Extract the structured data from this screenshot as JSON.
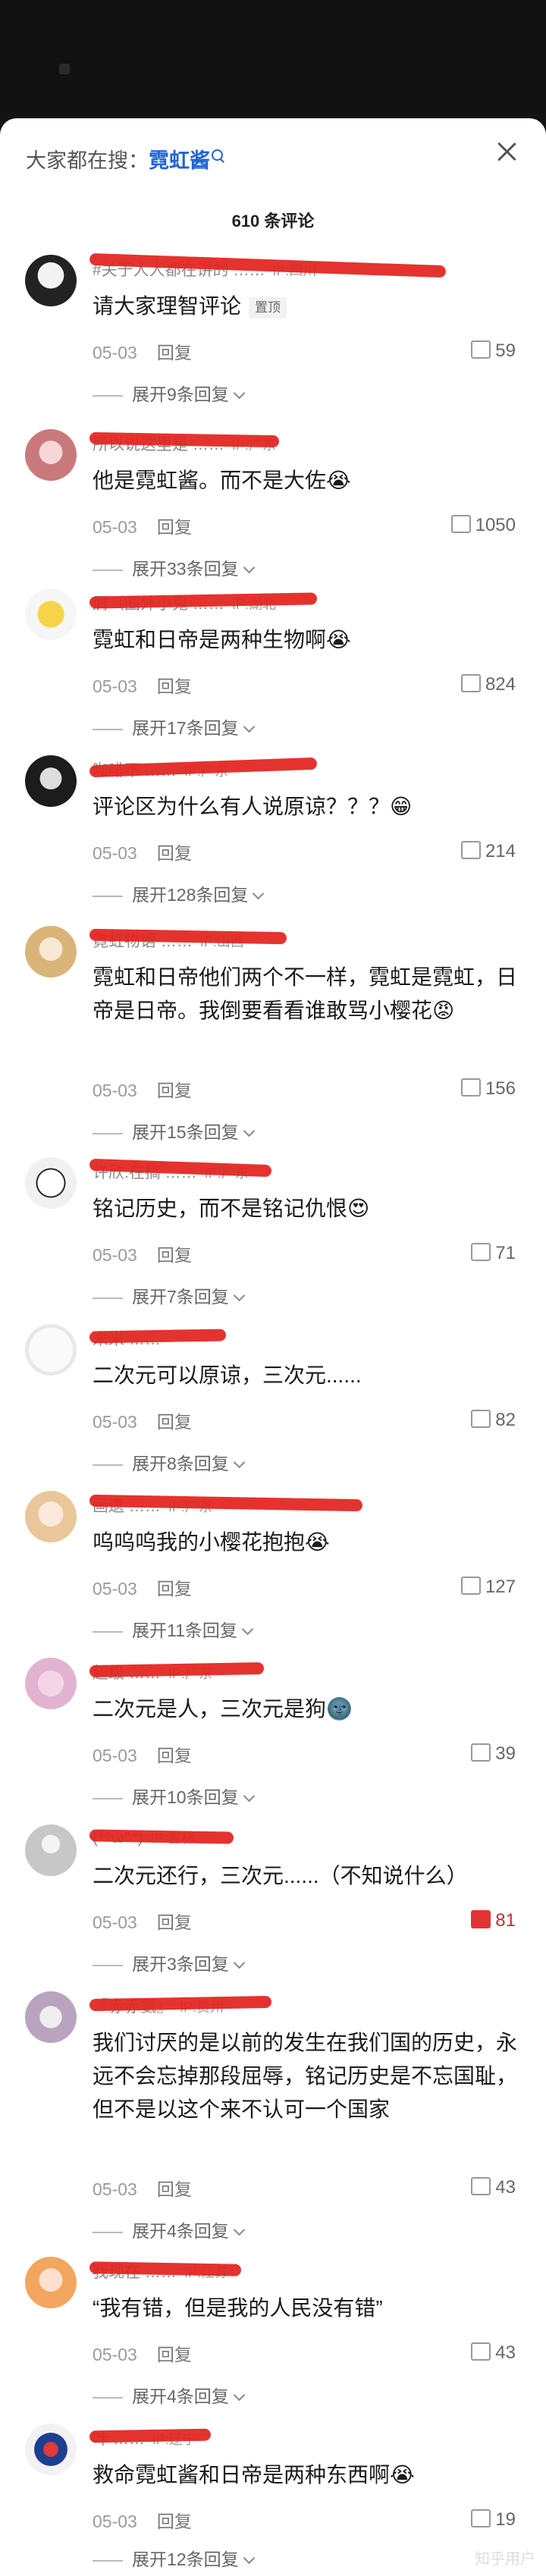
{
  "search": {
    "prefix": "大家都在搜：",
    "keyword": "霓虹酱"
  },
  "comment_count": "610 条评论",
  "actions": {
    "reply": "回复"
  },
  "watermark": "知乎用户",
  "colors": {
    "accent": "#1f64d8",
    "redact": "#e2231f",
    "liked": "#e23333"
  },
  "comments": [
    {
      "user": "#关于人人都在讲的 ……",
      "ip": "IP:四川",
      "text": "请大家理智评论",
      "tag": "置顶",
      "date": "05-03",
      "likes": "59",
      "expand": "展开9条回复"
    },
    {
      "user": "所以说这里是 ……",
      "ip": "IP:广东",
      "text": "他是霓虹酱。而不是大佐😭",
      "date": "05-03",
      "likes": "1050",
      "expand": "展开33条回复"
    },
    {
      "user": "屑（圈外小鬼 ……",
      "ip": "IP:湖北",
      "text": "霓虹和日帝是两种生物啊😭",
      "date": "05-03",
      "likes": "824",
      "expand": "展开17条回复"
    },
    {
      "user": "咖啡不 ……",
      "ip": "IP:广东",
      "text": "评论区为什么有人说原谅？？？😁",
      "date": "05-03",
      "likes": "214",
      "expand": "展开128条回复"
    },
    {
      "user": "霓虹物语 ……",
      "ip": "IP:山西",
      "text": "霓虹和日帝他们两个不一样，霓虹是霓虹，日帝是日帝。我倒要看看谁敢骂小樱花😡",
      "date": "05-03",
      "likes": "156",
      "expand": "展开15条回复"
    },
    {
      "user": "许欣.在搞 ……",
      "ip": "IP:广东",
      "text": "铭记历史，而不是铭记仇恨😍",
      "date": "05-03",
      "likes": "71",
      "expand": "展开7条回复"
    },
    {
      "user": "米米 ……",
      "ip": "",
      "text": "二次元可以原谅，三次元......",
      "date": "05-03",
      "likes": "82",
      "expand": "展开8条回复"
    },
    {
      "user": "画遗 ……",
      "ip": "IP:广东",
      "text": "呜呜呜我的小樱花抱抱😭",
      "date": "05-03",
      "likes": "127",
      "expand": "展开11条回复"
    },
    {
      "user": "超级 ……",
      "ip": "IP:广东",
      "text": "二次元是人，三次元是狗🌚",
      "date": "05-03",
      "likes": "39",
      "expand": "展开10条回复"
    },
    {
      "user": "(*^ω^*)",
      "ip": "IP:吉林",
      "text": "二次元还行，三次元......（不知说什么）",
      "date": "05-03",
      "likes": "81",
      "expand": "展开3条回复"
    },
    {
      "user": "『赤赤氨』",
      "ip": "IP:贵州",
      "text": "我们讨厌的是以前的发生在我们国的历史，永远不会忘掉那段屈辱，铭记历史是不忘国耻，但不是以这个来不认可一个国家",
      "date": "05-03",
      "likes": "43",
      "expand": "展开4条回复"
    },
    {
      "user": "我现在 ……",
      "ip": "IP:江苏",
      "text": "“我有错，但是我的人民没有错”",
      "date": "05-03",
      "likes": "43",
      "expand": "展开4条回复"
    },
    {
      "user": "叶 ……",
      "ip": "IP:辽宁",
      "text": "救命霓虹酱和日帝是两种东西啊😭",
      "date": "05-03",
      "likes": "19",
      "expand": "展开12条回复"
    }
  ]
}
